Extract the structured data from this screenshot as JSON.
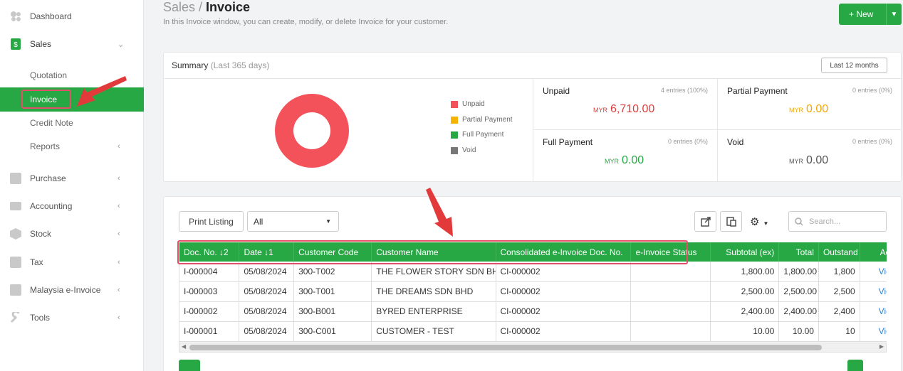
{
  "sidebar": {
    "items": [
      {
        "label": "Dashboard",
        "icon": "dashboard-icon"
      },
      {
        "label": "Sales",
        "icon": "sales-icon",
        "chev": "⌄"
      },
      {
        "label": "Quotation"
      },
      {
        "label": "Invoice"
      },
      {
        "label": "Credit Note"
      },
      {
        "label": "Reports",
        "chev": "‹"
      },
      {
        "label": "Purchase",
        "icon": "purchase-icon",
        "chev": "‹"
      },
      {
        "label": "Accounting",
        "icon": "accounting-icon",
        "chev": "‹"
      },
      {
        "label": "Stock",
        "icon": "stock-icon",
        "chev": "‹"
      },
      {
        "label": "Tax",
        "icon": "tax-icon",
        "chev": "‹"
      },
      {
        "label": "Malaysia e-Invoice",
        "icon": "e-invoice-icon",
        "chev": "‹"
      },
      {
        "label": "Tools",
        "icon": "tools-icon",
        "chev": "‹"
      }
    ]
  },
  "header": {
    "crumb": "Sales / ",
    "title": "Invoice",
    "subtitle": "In this Invoice window, you can create, modify, or delete Invoice for your customer.",
    "new_label": "+  New"
  },
  "summary": {
    "title": "Summary",
    "period": "(Last 365 days)",
    "range_button": "Last 12 months",
    "legend": [
      {
        "label": "Unpaid",
        "color": "#f4525a"
      },
      {
        "label": "Partial Payment",
        "color": "#f5b400"
      },
      {
        "label": "Full Payment",
        "color": "#28a745"
      },
      {
        "label": "Void",
        "color": "#777777"
      }
    ],
    "stats": [
      {
        "title": "Unpaid",
        "entries": "4 entries (100%)",
        "currency": "MYR",
        "amount": "6,710.00",
        "color": "#e03c3c"
      },
      {
        "title": "Partial Payment",
        "entries": "0 entries (0%)",
        "currency": "MYR",
        "amount": "0.00",
        "color": "#f0a800"
      },
      {
        "title": "Full Payment",
        "entries": "0 entries (0%)",
        "currency": "MYR",
        "amount": "0.00",
        "color": "#28a745"
      },
      {
        "title": "Void",
        "entries": "0 entries (0%)",
        "currency": "MYR",
        "amount": "0.00",
        "color": "#555555"
      }
    ]
  },
  "toolbar": {
    "print_label": "Print Listing",
    "filter_value": "All",
    "search_placeholder": "Search..."
  },
  "table": {
    "columns": [
      "Doc. No. ↓2",
      "Date   ↓1",
      "Customer Code",
      "Customer Name",
      "Consolidated e-Invoice Doc. No.",
      "e-Invoice Status",
      "Subtotal (ex)",
      "Total",
      "Outstand",
      "Action"
    ],
    "rows": [
      [
        "I-000004",
        "05/08/2024",
        "300-T002",
        "THE FLOWER STORY SDN BHD",
        "CI-000002",
        "",
        "1,800.00",
        "1,800.00",
        "1,800",
        "View"
      ],
      [
        "I-000003",
        "05/08/2024",
        "300-T001",
        "THE DREAMS SDN BHD",
        "CI-000002",
        "",
        "2,500.00",
        "2,500.00",
        "2,500",
        "View"
      ],
      [
        "I-000002",
        "05/08/2024",
        "300-B001",
        "BYRED ENTERPRISE",
        "CI-000002",
        "",
        "2,400.00",
        "2,400.00",
        "2,400",
        "View"
      ],
      [
        "I-000001",
        "05/08/2024",
        "300-C001",
        "CUSTOMER - TEST",
        "CI-000002",
        "",
        "10.00",
        "10.00",
        "10",
        "View"
      ]
    ]
  }
}
